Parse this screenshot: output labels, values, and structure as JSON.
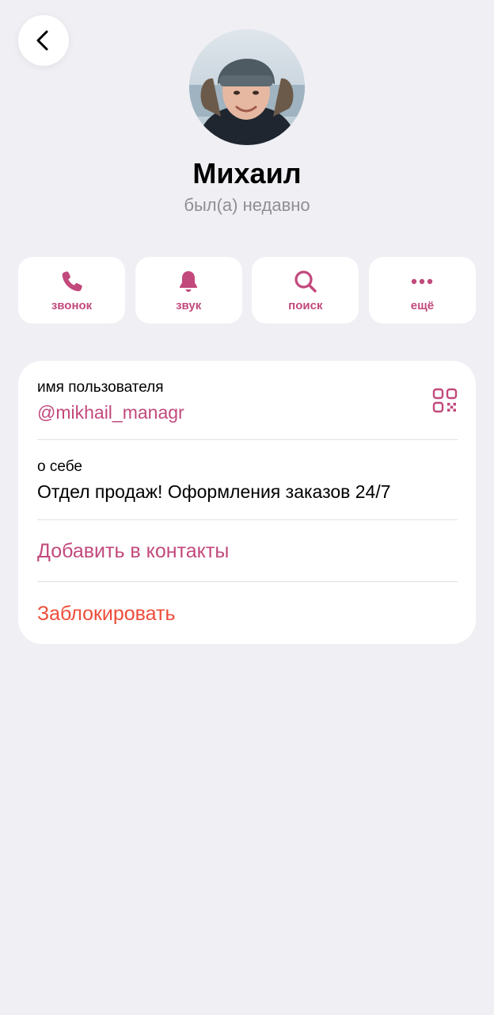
{
  "colors": {
    "accent": "#c2497c",
    "destructive": "#ed4d3a",
    "secondary_text": "#8e8e93",
    "background": "#efeff4"
  },
  "header": {
    "back_icon": "chevron-left-icon"
  },
  "profile": {
    "name": "Михаил",
    "status": "был(а) недавно"
  },
  "actions": [
    {
      "label": "звонок",
      "icon": "phone-icon"
    },
    {
      "label": "звук",
      "icon": "bell-icon"
    },
    {
      "label": "поиск",
      "icon": "search-icon"
    },
    {
      "label": "ещё",
      "icon": "more-dots-icon"
    }
  ],
  "info": {
    "username_caption": "имя пользователя",
    "username": "@mikhail_managr",
    "about_caption": "о себе",
    "about": "Отдел продаж! Оформления заказов 24/7",
    "add_contact": "Добавить в контакты",
    "block": "Заблокировать",
    "qr_icon": "qr-code-icon"
  }
}
